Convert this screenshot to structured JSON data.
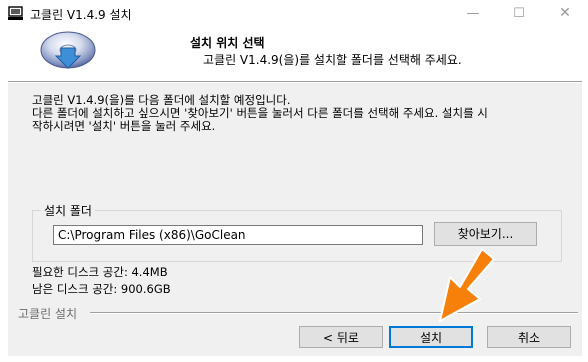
{
  "window": {
    "title": "고클린 V1.4.9 설치",
    "minimize_glyph": "—",
    "maximize_glyph": "☐",
    "close_glyph": "✕"
  },
  "header": {
    "title": "설치 위치 선택",
    "subtitle": "고클린 V1.4.9(을)를 설치할 폴더를 선택해 주세요."
  },
  "description": {
    "line1": "고클린 V1.4.9(을)를 다음 폴더에 설치할 예정입니다.",
    "line2": "다른 폴더에 설치하고 싶으시면 '찾아보기' 버튼을 눌러서 다른 폴더를 선택해 주세요. 설치를 시",
    "line3": "작하시려면 '설치' 버튼을 눌러 주세요."
  },
  "install_folder": {
    "label": "설치 폴더",
    "value": "C:\\Program Files (x86)\\GoClean",
    "browse_label": "찾아보기..."
  },
  "disk": {
    "required": "필요한 디스크 공간: 4.4MB",
    "available": "남은 디스크 공간: 900.6GB"
  },
  "footer": {
    "brand": "고클린 설치",
    "back_label": "< 뒤로",
    "install_label": "설치",
    "cancel_label": "취소"
  },
  "icons": {
    "app": "installer-app-icon",
    "logo": "install-disk-icon",
    "pointer": "orange-arrow-icon"
  },
  "colors": {
    "dialog_bg": "#f0f0f0",
    "focus_border": "#0078d7",
    "arrow": "#f7800a"
  }
}
